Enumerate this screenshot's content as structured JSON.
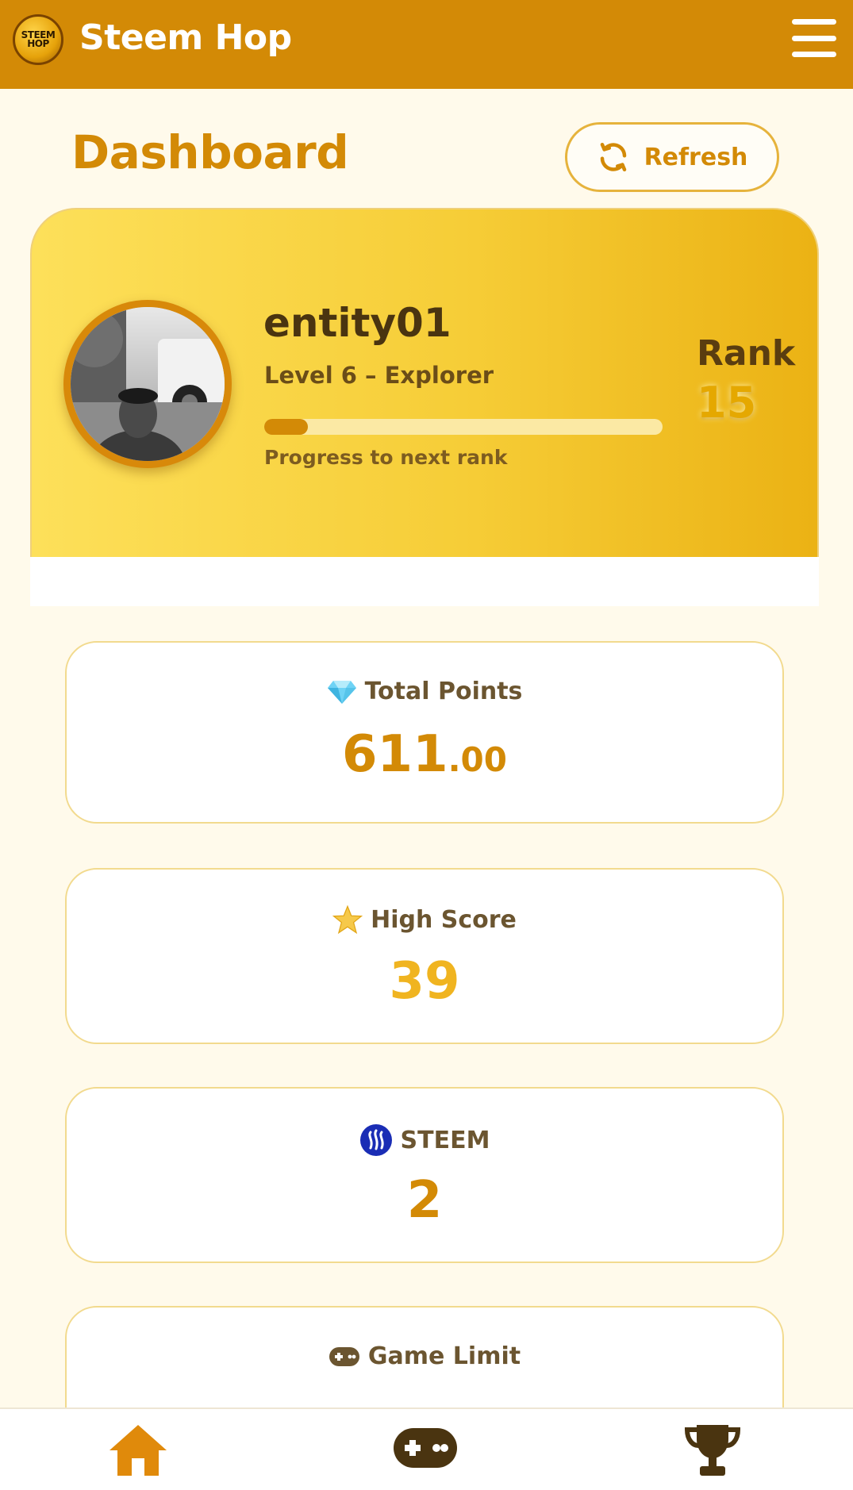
{
  "header": {
    "app_title": "Steem Hop",
    "logo_text_line1": "STEEM",
    "logo_text_line2": "HOP",
    "menu_icon": "hamburger-menu-icon"
  },
  "dashboard": {
    "title": "Dashboard",
    "refresh_label": "Refresh",
    "refresh_icon": "refresh-icon"
  },
  "profile": {
    "username": "entity01",
    "level_text": "Level 6 – Explorer",
    "progress_fraction": 0.11,
    "progress_label": "Progress to next rank",
    "rank_label": "Rank",
    "rank_value": "15"
  },
  "stats": {
    "total_points": {
      "icon": "diamond-icon",
      "label": "Total Points",
      "value_int": "611",
      "value_dec": ".00"
    },
    "high_score": {
      "icon": "star-icon",
      "label": "High Score",
      "value": "39"
    },
    "steem": {
      "icon": "steem-logo-icon",
      "label": "STEEM",
      "value": "2"
    },
    "game_limit": {
      "icon": "gamepad-icon",
      "label": "Game Limit"
    }
  },
  "nav": {
    "items": [
      "home-icon",
      "gamepad-icon",
      "trophy-icon"
    ]
  },
  "colors": {
    "primary": "#d38a06",
    "header_bg": "#d38a06",
    "page_bg": "#fffaeb",
    "card_gradient_start": "#fde05a",
    "card_gradient_end": "#ebb214",
    "steem_blue": "#1a2db5"
  }
}
